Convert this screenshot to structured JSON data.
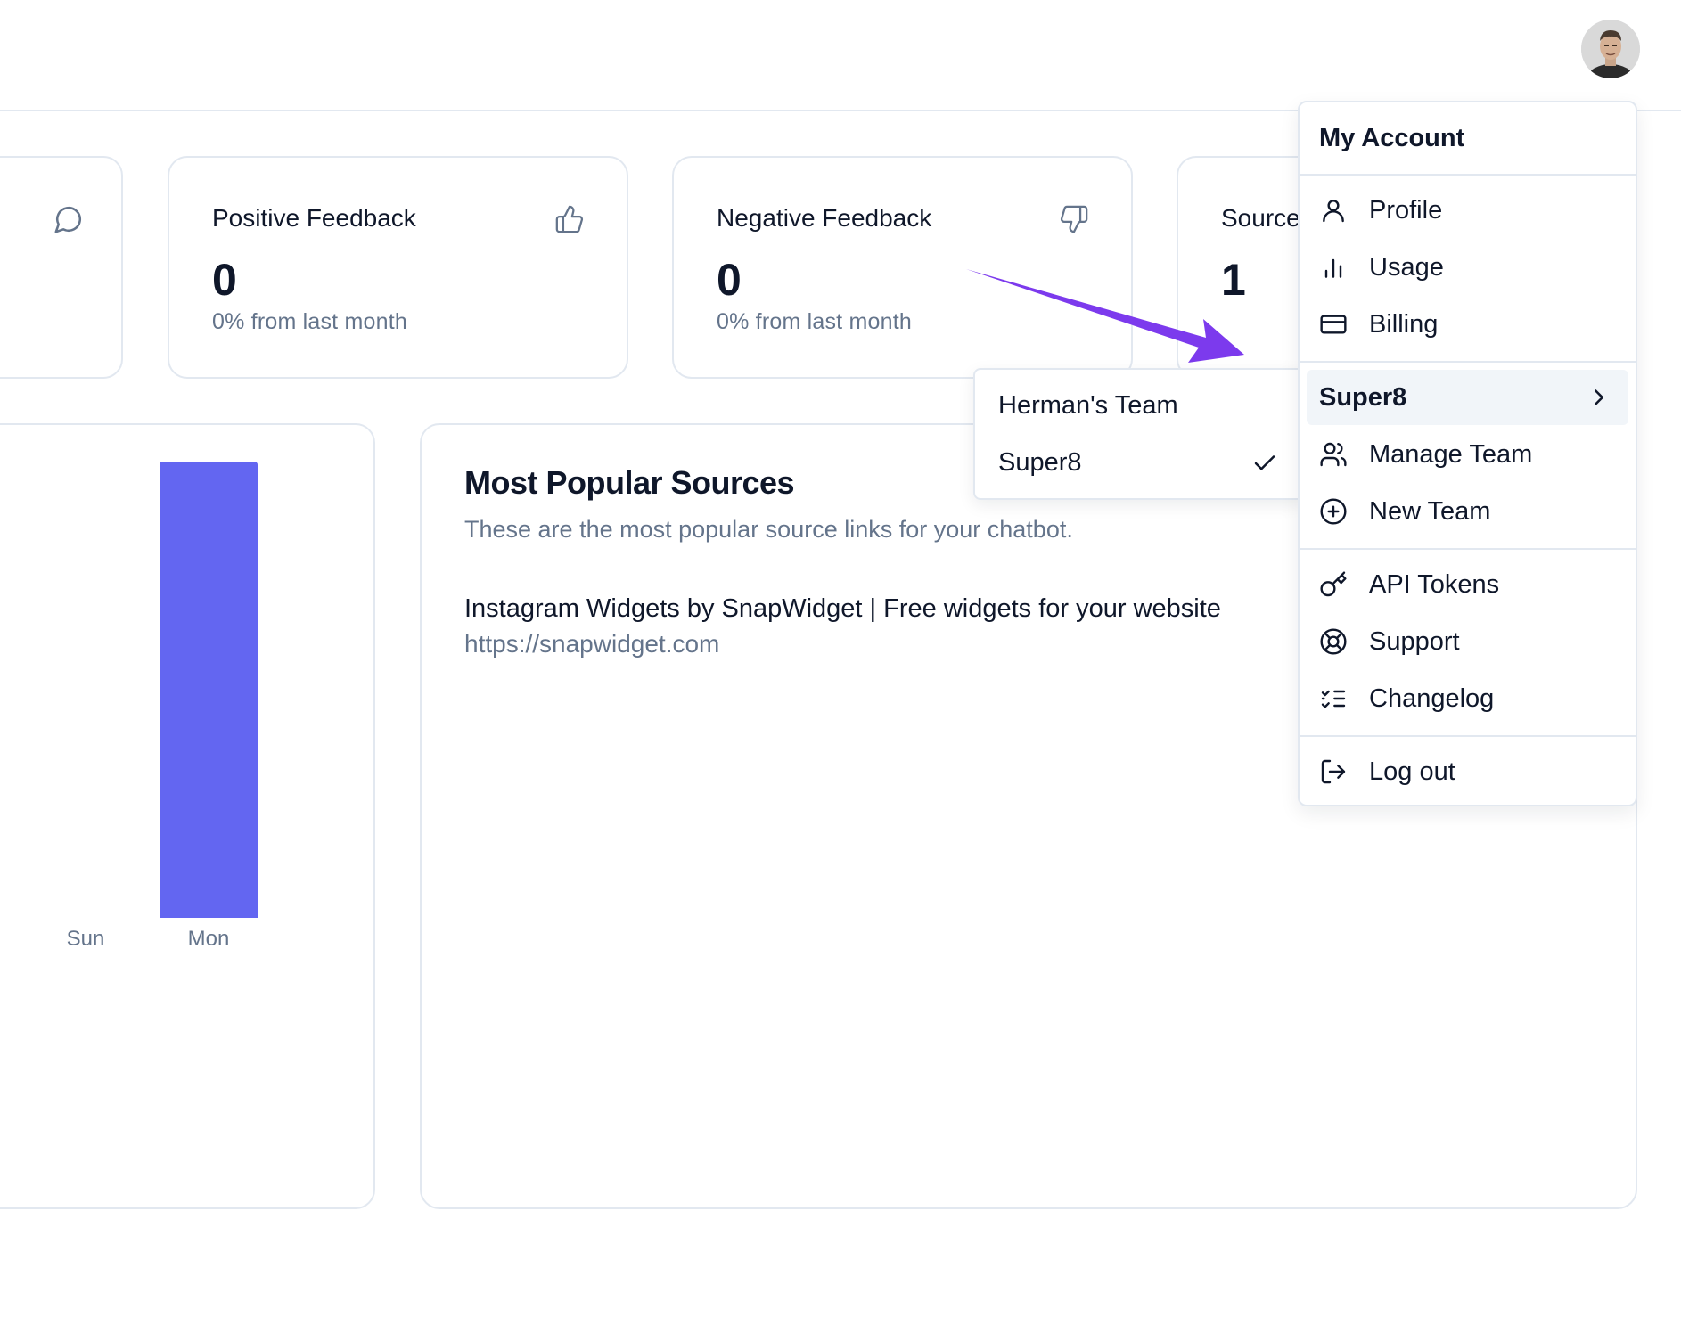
{
  "header": {
    "avatar_icon": "user-avatar-photo"
  },
  "stats": [
    {
      "title": "",
      "icon": "chat-bubble-icon"
    },
    {
      "title": "Positive Feedback",
      "value": "0",
      "sub": "0% from last month",
      "icon": "thumbs-up-icon"
    },
    {
      "title": "Negative Feedback",
      "value": "0",
      "sub": "0% from last month",
      "icon": "thumbs-down-icon"
    },
    {
      "title": "Sources",
      "value": "1"
    }
  ],
  "chart_data": {
    "type": "bar",
    "categories": [
      "Sun",
      "Mon"
    ],
    "values": [
      0,
      1
    ],
    "color": "#6366f1",
    "ylim": [
      0,
      1
    ],
    "grid": false
  },
  "sources": {
    "title": "Most Popular Sources",
    "description": "These are the most popular source links for your chatbot.",
    "items": [
      {
        "name": "Instagram Widgets by SnapWidget | Free widgets for your website",
        "url": "https://snapwidget.com"
      }
    ]
  },
  "team_submenu": {
    "items": [
      {
        "label": "Herman's Team",
        "checked": false
      },
      {
        "label": "Super8",
        "checked": true
      }
    ]
  },
  "account_menu": {
    "header": "My Account",
    "items": {
      "profile": "Profile",
      "usage": "Usage",
      "billing": "Billing",
      "team": "Super8",
      "manage_team": "Manage Team",
      "new_team": "New Team",
      "api_tokens": "API Tokens",
      "support": "Support",
      "changelog": "Changelog",
      "logout": "Log out"
    }
  },
  "colors": {
    "accent": "#6366f1",
    "arrow": "#7c3aed",
    "border": "#e2e8f0",
    "muted_text": "#64748b"
  }
}
